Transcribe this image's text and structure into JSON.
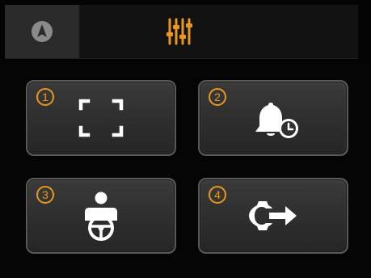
{
  "topbar": {
    "nav_tab_icon": "navigation-arrow-icon",
    "settings_tab_icon": "equalizer-sliders-icon"
  },
  "tiles": [
    {
      "number": "1",
      "icon": "frame-corners-icon"
    },
    {
      "number": "2",
      "icon": "bell-clock-icon"
    },
    {
      "number": "3",
      "icon": "driver-steering-wheel-icon"
    },
    {
      "number": "4",
      "icon": "connector-arrow-icon"
    }
  ],
  "colors": {
    "accent": "#e8981e",
    "icon_white": "#ffffff",
    "tile_background": "#333333",
    "tile_border": "#5a5a5a",
    "active_tab": "#2b2b2b"
  }
}
